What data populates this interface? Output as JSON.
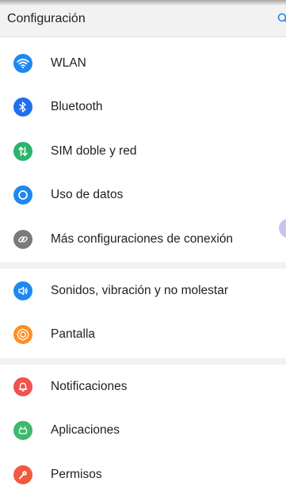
{
  "header": {
    "title": "Configuración",
    "search_icon": "search-icon"
  },
  "colors": {
    "blue": "#1e88f0",
    "green": "#2db36a",
    "grey": "#7a7a7a",
    "orange": "#ff8f1f",
    "red": "#f0524f",
    "android_green": "#3fb86c",
    "coral": "#f25a3e"
  },
  "sections": [
    {
      "items": [
        {
          "label": "WLAN",
          "icon": "wifi-icon",
          "color": "#1e88f0"
        },
        {
          "label": "Bluetooth",
          "icon": "bluetooth-icon",
          "color": "#1e6ff0"
        },
        {
          "label": "SIM doble y red",
          "icon": "sim-data-icon",
          "color": "#2db36a"
        },
        {
          "label": "Uso de datos",
          "icon": "data-usage-icon",
          "color": "#1e88f0"
        },
        {
          "label": "Más configuraciones de conexión",
          "icon": "link-icon",
          "color": "#7a7a7a"
        }
      ]
    },
    {
      "items": [
        {
          "label": "Sonidos, vibración y no molestar",
          "icon": "speaker-icon",
          "color": "#1e88f0"
        },
        {
          "label": "Pantalla",
          "icon": "brightness-icon",
          "color": "#ff8f1f"
        }
      ]
    },
    {
      "items": [
        {
          "label": "Notificaciones",
          "icon": "bell-icon",
          "color": "#f0524f"
        },
        {
          "label": "Aplicaciones",
          "icon": "android-icon",
          "color": "#3fb86c"
        },
        {
          "label": "Permisos",
          "icon": "key-icon",
          "color": "#f25a3e"
        }
      ]
    }
  ]
}
